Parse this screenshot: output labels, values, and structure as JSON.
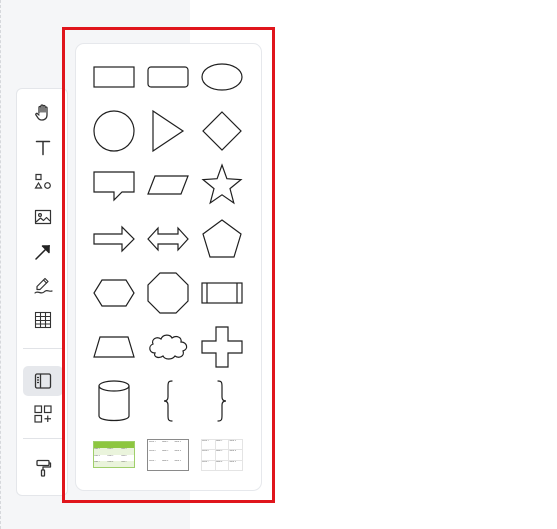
{
  "toolbar": {
    "tools": [
      {
        "name": "hand-icon"
      },
      {
        "name": "text-tool-icon"
      },
      {
        "name": "shapes-icon"
      },
      {
        "name": "image-icon"
      },
      {
        "name": "arrow-icon"
      },
      {
        "name": "pen-icon"
      },
      {
        "name": "table-icon"
      },
      {
        "name": "sidebar-panel-icon",
        "active": true
      },
      {
        "name": "add-widget-icon"
      },
      {
        "name": "format-painter-icon"
      }
    ]
  },
  "shapes_panel": {
    "shapes": [
      "rectangle",
      "rounded-rectangle",
      "ellipse",
      "circle",
      "triangle",
      "diamond",
      "callout",
      "parallelogram",
      "star",
      "right-arrow",
      "double-arrow",
      "pentagon",
      "hexagon",
      "octagon",
      "process",
      "trapezoid",
      "cloud",
      "cross",
      "cylinder",
      "left-brace",
      "right-brace",
      "table-green",
      "table-plain",
      "table-grid"
    ],
    "table_templates": {
      "green": {
        "header_color": "#8dc63f",
        "row_color": "#eaf4dc",
        "cells": [
          [
            "",
            "",
            ""
          ],
          [
            "Data 1",
            "Data 2",
            "Data 3"
          ],
          [
            "Data 4",
            "Data 5",
            "Data 6"
          ],
          [
            "Data 7",
            "Data 8",
            "Data 9"
          ]
        ]
      },
      "plain": {
        "cells": [
          [
            "Value 1",
            "Value 2",
            "Value 3"
          ],
          [
            "Value 4",
            "Value 5",
            "Value 6"
          ],
          [
            "Value 7",
            "Value 8",
            "Value 9"
          ]
        ]
      },
      "grid": {
        "cells": [
          [
            "Value 1",
            "Value 2",
            "Value 3"
          ],
          [
            "Value 4",
            "Value 5",
            "Value 6"
          ],
          [
            "Value 7",
            "Value 8",
            "Value 9"
          ]
        ]
      }
    }
  },
  "colors": {
    "highlight": "#e0151c",
    "stroke": "#1f1f1f",
    "sidebar_bg": "#f5f6f8"
  }
}
